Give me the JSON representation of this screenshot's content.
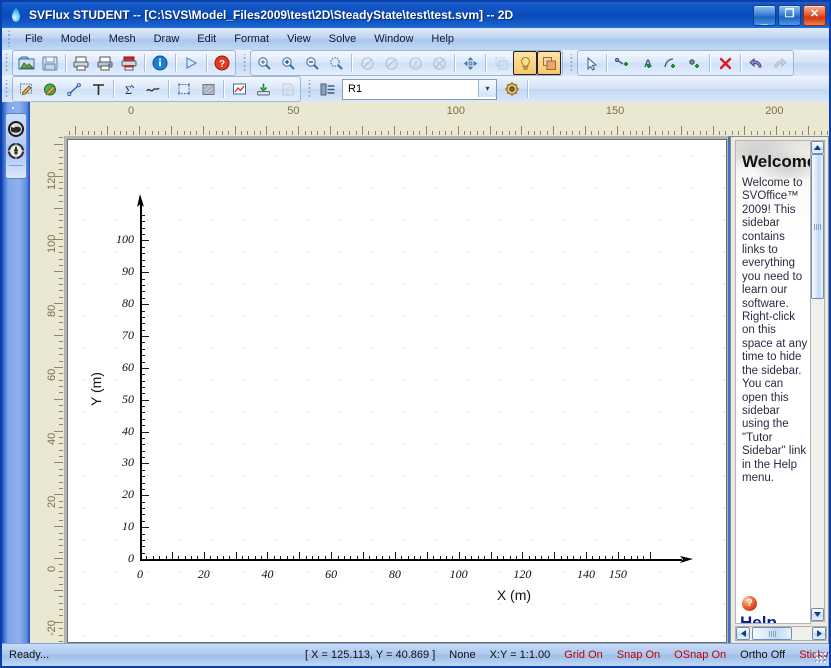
{
  "window": {
    "title": "SVFlux STUDENT -- [C:\\SVS\\Model_Files2009\\test\\2D\\SteadyState\\test\\test.svm] -- 2D",
    "app_icon": "water-drop-icon",
    "minimize_label": "_",
    "maximize_label": "❐",
    "close_label": "✕"
  },
  "menu": {
    "items": [
      {
        "label": "File"
      },
      {
        "label": "Model"
      },
      {
        "label": "Mesh"
      },
      {
        "label": "Draw"
      },
      {
        "label": "Edit"
      },
      {
        "label": "Format"
      },
      {
        "label": "View"
      },
      {
        "label": "Solve"
      },
      {
        "label": "Window"
      },
      {
        "label": "Help"
      }
    ]
  },
  "toolbars": {
    "standard": [
      {
        "name": "open-file-icon",
        "glyph": "🗁"
      },
      {
        "name": "save-icon",
        "glyph": "💾"
      },
      {
        "sep": true
      },
      {
        "name": "print-icon",
        "glyph": "🖨"
      },
      {
        "name": "print-setup-icon",
        "glyph": "🖨"
      },
      {
        "name": "print-preview-icon",
        "glyph": "🖨"
      },
      {
        "sep": true
      },
      {
        "name": "about-info-icon",
        "glyph": "i"
      },
      {
        "sep": true
      },
      {
        "name": "run-icon",
        "glyph": "▷"
      },
      {
        "sep": true
      },
      {
        "name": "help-icon",
        "glyph": "?"
      }
    ],
    "zoom": [
      {
        "name": "zoom-window-icon",
        "glyph": "⌕"
      },
      {
        "name": "zoom-in-icon",
        "glyph": "⌕"
      },
      {
        "name": "zoom-out-icon",
        "glyph": "⌕"
      },
      {
        "name": "zoom-extents-icon",
        "glyph": "⌕"
      },
      {
        "sep": true
      },
      {
        "name": "zoom-previous-icon",
        "glyph": "⊘",
        "dim": true
      },
      {
        "name": "zoom-next-icon",
        "glyph": "⊘",
        "dim": true
      },
      {
        "name": "zoom-realtime-icon",
        "glyph": "Ⓩ",
        "dim": true
      },
      {
        "name": "zoom-all-icon",
        "glyph": "⊗",
        "dim": true
      },
      {
        "sep": true
      },
      {
        "name": "pan-icon",
        "glyph": "✥"
      },
      {
        "sep": true
      },
      {
        "name": "redraw-icon",
        "glyph": "⧉",
        "dim": true
      },
      {
        "name": "light-toggle-icon",
        "glyph": "💡",
        "active": true
      },
      {
        "name": "shade-toggle-icon",
        "glyph": "◰",
        "active": true
      }
    ],
    "draw": [
      {
        "name": "select-arrow-icon",
        "glyph": "➳"
      },
      {
        "sep": true
      },
      {
        "name": "add-point-icon",
        "glyph": "⨯"
      },
      {
        "name": "add-label-icon",
        "glyph": "A"
      },
      {
        "name": "add-arc-icon",
        "glyph": "⌒"
      },
      {
        "name": "add-node-icon",
        "glyph": "●"
      },
      {
        "sep": true
      },
      {
        "name": "delete-icon",
        "glyph": "✖"
      },
      {
        "sep": true
      },
      {
        "name": "undo-icon",
        "glyph": "↶"
      },
      {
        "name": "redo-icon",
        "glyph": "↷",
        "dim": true
      }
    ],
    "model": [
      {
        "name": "region-properties-icon",
        "glyph": "✎"
      },
      {
        "name": "material-properties-icon",
        "glyph": "●"
      },
      {
        "name": "boundary-conditions-icon",
        "glyph": "↗"
      },
      {
        "name": "initial-conditions-icon",
        "glyph": "⊤"
      },
      {
        "sep": true
      },
      {
        "name": "flux-section-icon",
        "glyph": "Σ"
      },
      {
        "name": "water-table-icon",
        "glyph": "∿"
      },
      {
        "sep": true
      },
      {
        "name": "mesh-region-icon",
        "glyph": "⬚"
      },
      {
        "name": "mesh-fill-icon",
        "glyph": "░"
      },
      {
        "sep": true
      },
      {
        "name": "plot-results-icon",
        "glyph": "↗"
      },
      {
        "name": "export-icon",
        "glyph": "⤓"
      },
      {
        "name": "report-icon",
        "glyph": "⫼",
        "dim": true
      }
    ],
    "region": {
      "list_icon": "region-list-icon",
      "combo_value": "R1",
      "combo_arrow": "▾",
      "settings_icon": "region-settings-icon"
    }
  },
  "left_dock": {
    "buttons": [
      {
        "name": "model-explorer-icon"
      },
      {
        "name": "compass-orientation-icon"
      }
    ]
  },
  "rulers": {
    "horizontal": {
      "labels": [
        0,
        50,
        100,
        150,
        200
      ],
      "unit": "m"
    },
    "vertical": {
      "labels": [
        -20,
        0,
        20,
        40,
        60,
        80,
        100,
        120
      ],
      "unit": "m"
    }
  },
  "chart_data": {
    "type": "scatter",
    "title": "",
    "xlabel": "X (m)",
    "ylabel": "Y (m)",
    "xticks": [
      0,
      20,
      40,
      60,
      80,
      100,
      120,
      140,
      150
    ],
    "yticks": [
      0,
      10,
      20,
      30,
      40,
      50,
      60,
      70,
      80,
      90,
      100
    ],
    "xlim": [
      0,
      160
    ],
    "ylim": [
      0,
      108
    ],
    "grid": true,
    "grid_style": "dots",
    "series": [],
    "x": [],
    "y": [],
    "legend": false,
    "axis_scale_ratio": "1:1.00",
    "notes": "Empty SVFlux 2D model workspace: axes drawn with arrowheads, dotted snap grid, no geometry defined."
  },
  "sidebar": {
    "title": "Welcome",
    "body": "Welcome to SVOffice™ 2009! This sidebar contains links to everything you need to learn our software. Right-click on this space at any time to hide the sidebar. You can open this sidebar using the \"Tutor Sidebar\" link in the Help menu.",
    "help_icon": "?",
    "help_label": "Help",
    "scroll_up": "▲",
    "scroll_down": "▼",
    "scroll_left": "◀",
    "scroll_right": "▶"
  },
  "statusbar": {
    "ready": "Ready...",
    "coords": "[ X = 125.113, Y = 40.869 ]",
    "selection": "None",
    "ratio": "X:Y = 1:1.00",
    "grid": "Grid On",
    "snap": "Snap On",
    "osnap": "OSnap On",
    "ortho": "Ortho Off",
    "sticky": "Sticky On"
  },
  "colors": {
    "title_blue": "#0b4ec0",
    "toolbar_blue": "#c3d7f3",
    "ruler_beige": "#eae7d2",
    "canvas_white": "#ffffff",
    "status_red": "#c00000",
    "active_amber": "#f6c96b"
  }
}
